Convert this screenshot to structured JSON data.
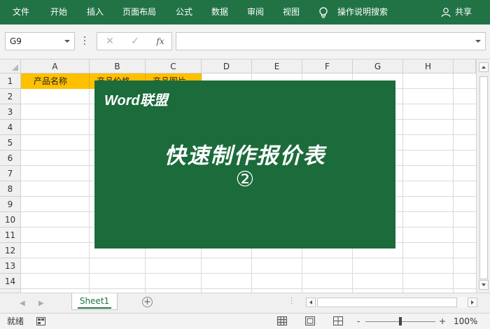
{
  "ribbon": {
    "tabs": [
      "文件",
      "开始",
      "插入",
      "页面布局",
      "公式",
      "数据",
      "审阅",
      "视图"
    ],
    "tell_me": "操作说明搜索",
    "share": "共享"
  },
  "formula_bar": {
    "name_box": "G9",
    "cancel_glyph": "✕",
    "enter_glyph": "✓",
    "fx_glyph": "fx",
    "formula": ""
  },
  "grid": {
    "columns": [
      "A",
      "B",
      "C",
      "D",
      "E",
      "F",
      "G",
      "H"
    ],
    "rows": [
      "1",
      "2",
      "3",
      "4",
      "5",
      "6",
      "7",
      "8",
      "9",
      "10",
      "11",
      "12",
      "13",
      "14"
    ],
    "header_cells": [
      "产品名称",
      "产品价格",
      "产品图片"
    ],
    "header_fill": "#ffc000"
  },
  "banner": {
    "brand": "Word联盟",
    "title": "快速制作报价表",
    "number": "②",
    "background": "#1c6b3b"
  },
  "sheets": {
    "tabs": [
      "Sheet1"
    ],
    "add_glyph": "+"
  },
  "status": {
    "ready": "就绪",
    "zoom_minus": "-",
    "zoom_plus": "+",
    "zoom": "100%"
  },
  "colors": {
    "accent": "#217346"
  }
}
